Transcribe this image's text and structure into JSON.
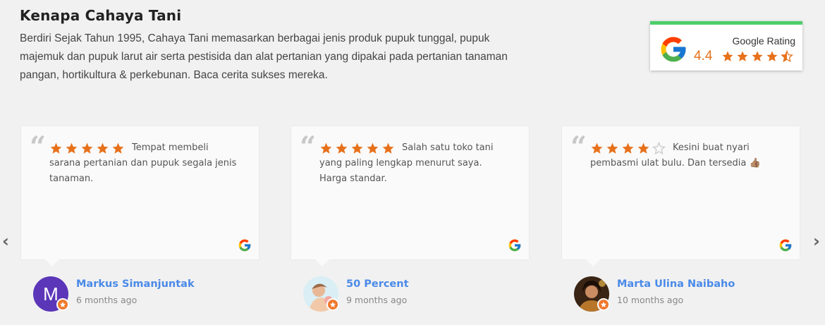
{
  "header": {
    "title": "Kenapa Cahaya Tani",
    "description": "Berdiri Sejak Tahun 1995, Cahaya Tani memasarkan berbagai jenis produk pupuk tunggal, pupuk majemuk dan pupuk larut air serta pestisida dan alat pertanian yang dipakai pada pertanian tanaman pangan, hortikultura & perkebunan. Baca cerita sukses mereka."
  },
  "google_rating": {
    "label": "Google Rating",
    "score": "4.4",
    "stars": 4.5,
    "accent_color": "#4fce6a",
    "score_color": "#e7711b"
  },
  "reviews": [
    {
      "stars": 5,
      "text": "Tempat membeli sarana pertanian dan pupuk segala jenis tanaman.",
      "author": "Markus Simanjuntak",
      "time": "6 months ago",
      "avatar_letter": "M",
      "avatar_color": "#5b36b8"
    },
    {
      "stars": 5,
      "text": "Salah satu toko tani yang paling lengkap menurut saya. Harga standar.",
      "author": "50 Percent",
      "time": "9 months ago",
      "avatar_letter": "",
      "avatar_color": "#cfe6ef"
    },
    {
      "stars": 4,
      "text": "Kesini buat nyari pembasmi ulat bulu. Dan tersedia 👍🏽",
      "author": "Marta Ulina Naibaho",
      "time": "10 months ago",
      "avatar_letter": "",
      "avatar_color": "#6b3d1c"
    }
  ],
  "nav": {
    "prev": "‹",
    "next": "›"
  },
  "icons": {
    "star": "star-icon",
    "google": "google-g-icon",
    "quote": "quote-icon",
    "badge": "local-guide-badge-icon"
  },
  "colors": {
    "star": "#e7711b",
    "star_empty": "#c9c9c9",
    "author_name": "#4a8ae8"
  }
}
